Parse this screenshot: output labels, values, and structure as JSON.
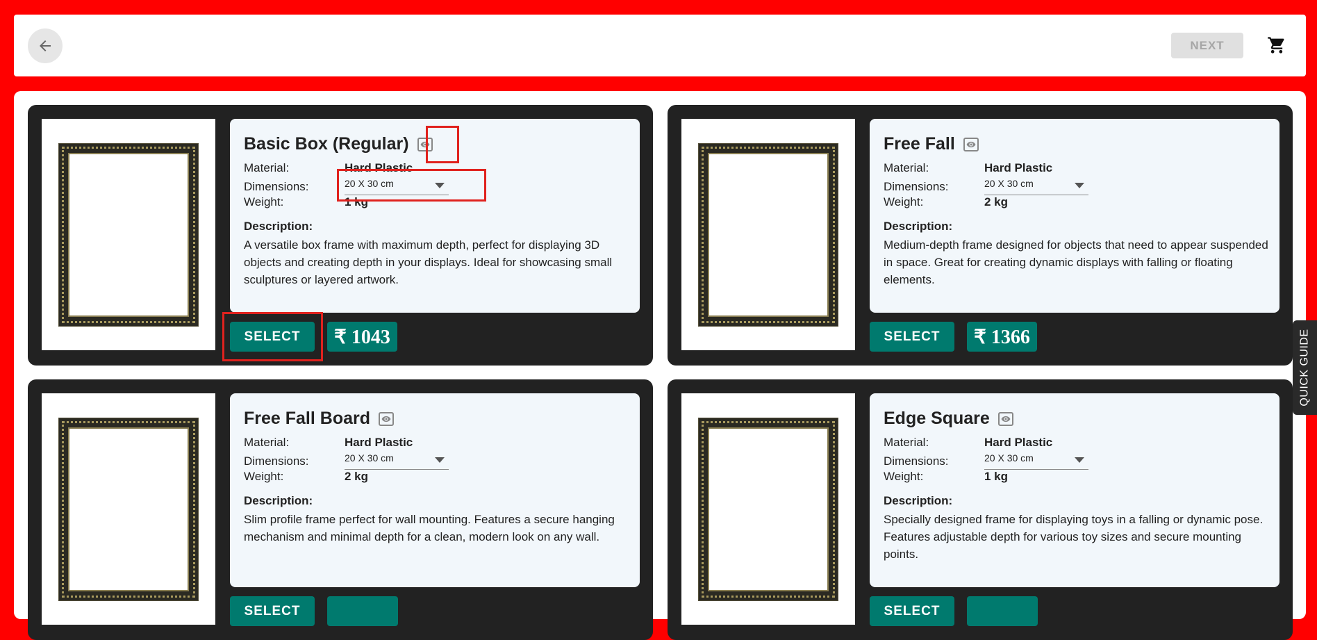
{
  "header": {
    "back_icon": "arrow-left-icon",
    "next_label": "NEXT",
    "cart_icon": "shopping-cart-icon"
  },
  "labels": {
    "material": "Material:",
    "dimensions": "Dimensions:",
    "weight": "Weight:",
    "description": "Description:",
    "select": "SELECT"
  },
  "products": [
    {
      "title": "Basic Box (Regular)",
      "material": "Hard Plastic",
      "dimensions": "20 X 30 cm",
      "weight": "1 kg",
      "description": "A versatile box frame with maximum depth, perfect for displaying 3D objects and creating depth in your displays. Ideal for showcasing small sculptures or layered artwork.",
      "price": "₹ 1043"
    },
    {
      "title": "Free Fall",
      "material": "Hard Plastic",
      "dimensions": "20 X 30 cm",
      "weight": "2 kg",
      "description": "Medium-depth frame designed for objects that need to appear suspended in space. Great for creating dynamic displays with falling or floating elements.",
      "price": "₹ 1366"
    },
    {
      "title": "Free Fall Board",
      "material": "Hard Plastic",
      "dimensions": "20 X 30 cm",
      "weight": "2 kg",
      "description": "Slim profile frame perfect for wall mounting. Features a secure hanging mechanism and minimal depth for a clean, modern look on any wall.",
      "price": ""
    },
    {
      "title": "Edge Square",
      "material": "Hard Plastic",
      "dimensions": "20 X 30 cm",
      "weight": "1 kg",
      "description": "Specially designed frame for displaying toys in a falling or dynamic pose. Features adjustable depth for various toy sizes and secure mounting points.",
      "price": ""
    }
  ],
  "quick_guide": "QUICK GUIDE",
  "colors": {
    "background": "#ff0000",
    "accent": "#007a6e",
    "card": "#222222",
    "highlight": "#e0221e"
  }
}
